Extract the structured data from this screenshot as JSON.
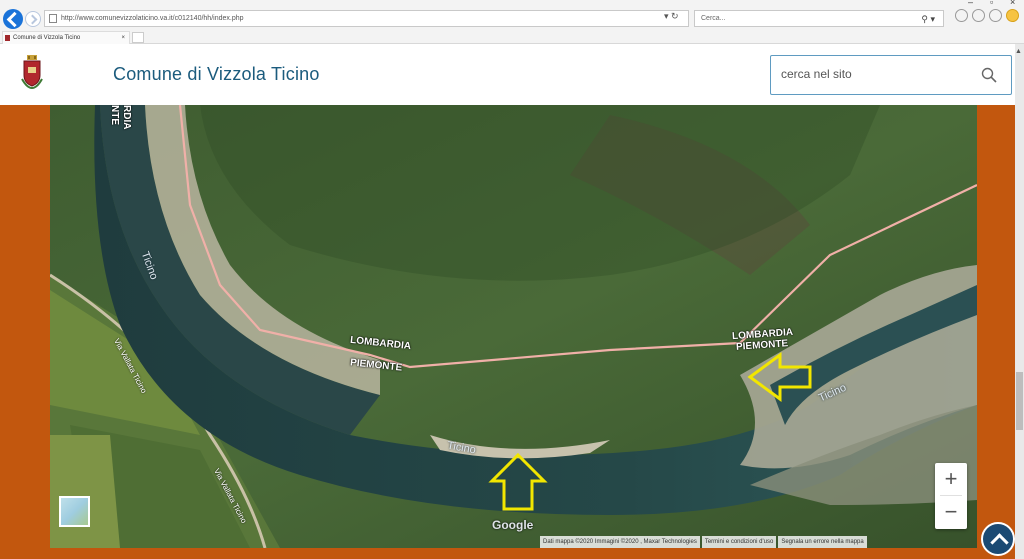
{
  "browser": {
    "address_url": "http://www.comunevizzolaticino.va.it/c012140/hh/index.php",
    "search_placeholder": "Cerca...",
    "tab_title": "Comune di Vizzola Ticino",
    "tab_close": "×"
  },
  "header": {
    "title": "Comune di Vizzola Ticino",
    "search_placeholder": "cerca nel sito"
  },
  "map": {
    "labels": {
      "road_top": "RDIA",
      "road_top2": "NTE",
      "lombardia_left": "LOMBARDIA",
      "piemonte_left": "PIEMONTE",
      "lombardia_right": "LOMBARDIA",
      "piemonte_right": "PIEMONTE",
      "ticino_upper": "Ticino",
      "ticino_bottom": "Ticino",
      "ticino_right": "Ticino",
      "via_vallata_1": "Via Vallata Ticino",
      "via_vallata_2": "Via Vallata Ticino"
    },
    "zoom_in": "+",
    "zoom_out": "−",
    "google_logo": "Google",
    "attribution": {
      "data": "Dati mappa ©2020 Immagini ©2020 , Maxar Technologies",
      "terms": "Termini e condizioni d'uso",
      "report": "Segnala un errore nella mappa"
    }
  },
  "colors": {
    "page_background": "#c2570e",
    "title_color": "#1b5b7d",
    "arrow_color": "#f2e600",
    "border_line": "#f0b0a8"
  }
}
